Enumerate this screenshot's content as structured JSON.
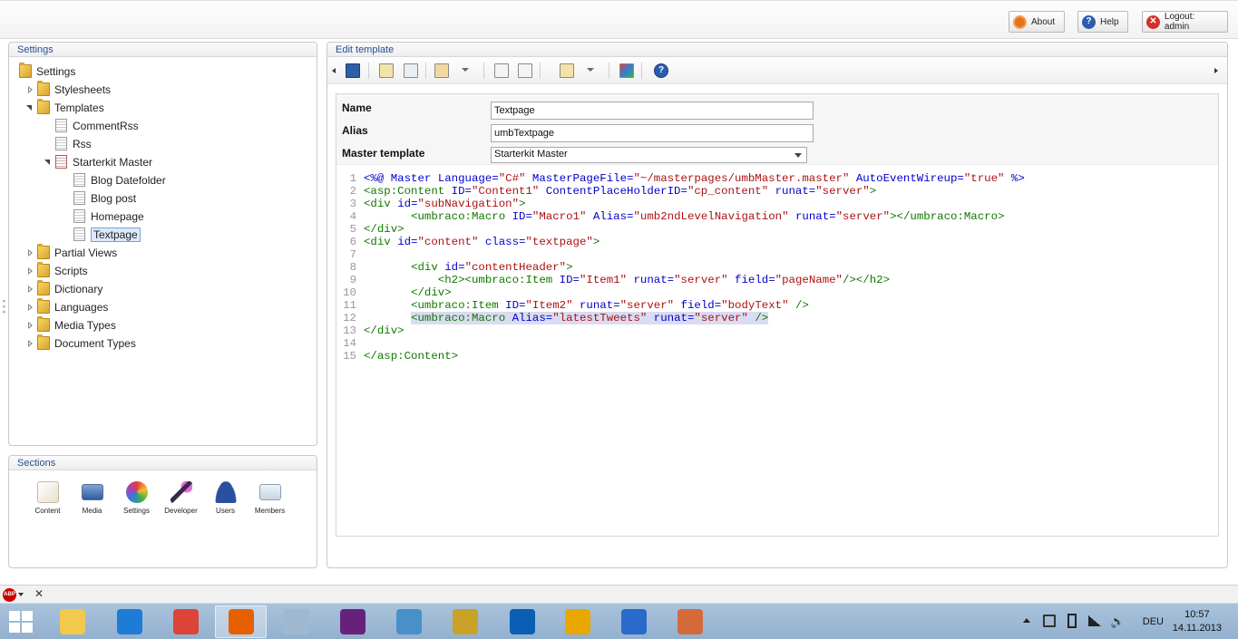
{
  "topbar": {
    "about_label": "About",
    "help_label": "Help",
    "logout_label": "Logout: admin"
  },
  "settings_panel": {
    "title": "Settings",
    "tree": [
      {
        "label": "Settings"
      },
      {
        "label": "Stylesheets"
      },
      {
        "label": "Templates"
      },
      {
        "label": "CommentRss"
      },
      {
        "label": "Rss"
      },
      {
        "label": "Starterkit Master"
      },
      {
        "label": "Blog Datefolder"
      },
      {
        "label": "Blog post"
      },
      {
        "label": "Homepage"
      },
      {
        "label": "Textpage"
      },
      {
        "label": "Partial Views"
      },
      {
        "label": "Scripts"
      },
      {
        "label": "Dictionary"
      },
      {
        "label": "Languages"
      },
      {
        "label": "Media Types"
      },
      {
        "label": "Document Types"
      }
    ]
  },
  "sections_panel": {
    "title": "Sections",
    "items": [
      {
        "label": "Content",
        "icon": "content-icon",
        "color": "#e8e0d0"
      },
      {
        "label": "Media",
        "icon": "media-icon",
        "color": "#5a88c8"
      },
      {
        "label": "Settings",
        "icon": "settings-icon",
        "color": "#e0a030"
      },
      {
        "label": "Developer",
        "icon": "developer-icon",
        "color": "#8a3aa8"
      },
      {
        "label": "Users",
        "icon": "users-icon",
        "color": "#2a4f9e"
      },
      {
        "label": "Members",
        "icon": "members-icon",
        "color": "#b8c8d8"
      }
    ]
  },
  "editor": {
    "title": "Edit template",
    "name_label": "Name",
    "name_value": "Textpage",
    "alias_label": "Alias",
    "alias_value": "umbTextpage",
    "master_label": "Master template",
    "master_value": "Starterkit Master",
    "code_lines": [
      {
        "n": "1",
        "parts": [
          [
            "t-dir",
            "<%@ "
          ],
          [
            "t-dir",
            "Master "
          ],
          [
            "t-att",
            "Language="
          ],
          [
            "t-str",
            "\"C#\""
          ],
          [
            "t-att",
            " MasterPageFile="
          ],
          [
            "t-str",
            "\"~/masterpages/umbMaster.master\""
          ],
          [
            "t-att",
            " AutoEventWireup="
          ],
          [
            "t-str",
            "\"true\""
          ],
          [
            "t-dir",
            " %>"
          ]
        ]
      },
      {
        "n": "2",
        "parts": [
          [
            "t-tag",
            "<asp:Content "
          ],
          [
            "t-att",
            "ID="
          ],
          [
            "t-str",
            "\"Content1\""
          ],
          [
            "t-att",
            " ContentPlaceHolderID="
          ],
          [
            "t-str",
            "\"cp_content\""
          ],
          [
            "t-att",
            " runat="
          ],
          [
            "t-str",
            "\"server\""
          ],
          [
            "t-tag",
            ">"
          ]
        ]
      },
      {
        "n": "3",
        "parts": [
          [
            "t-tag",
            "<div "
          ],
          [
            "t-att",
            "id="
          ],
          [
            "t-str",
            "\"subNavigation\""
          ],
          [
            "t-tag",
            ">"
          ]
        ]
      },
      {
        "n": "4",
        "parts": [
          [
            "",
            "       "
          ],
          [
            "t-tag",
            "<umbraco:Macro "
          ],
          [
            "t-att",
            "ID="
          ],
          [
            "t-str",
            "\"Macro1\""
          ],
          [
            "t-att",
            " Alias="
          ],
          [
            "t-str",
            "\"umb2ndLevelNavigation\""
          ],
          [
            "t-att",
            " runat="
          ],
          [
            "t-str",
            "\"server\""
          ],
          [
            "t-tag",
            "></umbraco:Macro>"
          ]
        ]
      },
      {
        "n": "5",
        "parts": [
          [
            "t-tag",
            "</div>"
          ]
        ]
      },
      {
        "n": "6",
        "parts": [
          [
            "t-tag",
            "<div "
          ],
          [
            "t-att",
            "id="
          ],
          [
            "t-str",
            "\"content\""
          ],
          [
            "t-att",
            " class="
          ],
          [
            "t-str",
            "\"textpage\""
          ],
          [
            "t-tag",
            ">"
          ]
        ]
      },
      {
        "n": "7",
        "parts": []
      },
      {
        "n": "8",
        "parts": [
          [
            "",
            "       "
          ],
          [
            "t-tag",
            "<div "
          ],
          [
            "t-att",
            "id="
          ],
          [
            "t-str",
            "\"contentHeader\""
          ],
          [
            "t-tag",
            ">"
          ]
        ]
      },
      {
        "n": "9",
        "parts": [
          [
            "",
            "           "
          ],
          [
            "t-tag",
            "<h2><umbraco:Item "
          ],
          [
            "t-att",
            "ID="
          ],
          [
            "t-str",
            "\"Item1\""
          ],
          [
            "t-att",
            " runat="
          ],
          [
            "t-str",
            "\"server\""
          ],
          [
            "t-att",
            " field="
          ],
          [
            "t-str",
            "\"pageName\""
          ],
          [
            "t-tag",
            "/></h2>"
          ]
        ]
      },
      {
        "n": "10",
        "parts": [
          [
            "",
            "       "
          ],
          [
            "t-tag",
            "</div>"
          ]
        ]
      },
      {
        "n": "11",
        "parts": [
          [
            "",
            "       "
          ],
          [
            "t-tag",
            "<umbraco:Item "
          ],
          [
            "t-att",
            "ID="
          ],
          [
            "t-str",
            "\"Item2\""
          ],
          [
            "t-att",
            " runat="
          ],
          [
            "t-str",
            "\"server\""
          ],
          [
            "t-att",
            " field="
          ],
          [
            "t-str",
            "\"bodyText\""
          ],
          [
            "t-tag",
            " />"
          ]
        ]
      },
      {
        "n": "12",
        "hl": true,
        "parts": [
          [
            "",
            "       "
          ],
          [
            "t-tag",
            "<umbraco:Macro "
          ],
          [
            "t-att",
            "Alias="
          ],
          [
            "t-str",
            "\"latestTweets\""
          ],
          [
            "t-att",
            " runat="
          ],
          [
            "t-str",
            "\"server\""
          ],
          [
            "t-tag",
            " />"
          ]
        ]
      },
      {
        "n": "13",
        "parts": [
          [
            "t-tag",
            "</div>"
          ]
        ]
      },
      {
        "n": "14",
        "parts": []
      },
      {
        "n": "15",
        "parts": [
          [
            "t-tag",
            "</asp:Content>"
          ]
        ]
      }
    ]
  },
  "taskbar": {
    "language": "DEU",
    "time": "10:57",
    "date": "14.11.2013",
    "apps": [
      {
        "icon": "explorer-icon",
        "color": "#f2c94c"
      },
      {
        "icon": "internet-explorer-icon",
        "color": "#1e7bd6"
      },
      {
        "icon": "chrome-icon",
        "color": "#db4437"
      },
      {
        "icon": "firefox-icon",
        "color": "#e66000"
      },
      {
        "icon": "server-icon",
        "color": "#9fb8cf"
      },
      {
        "icon": "visual-studio-icon",
        "color": "#68217a"
      },
      {
        "icon": "image-viewer-icon",
        "color": "#4a90c8"
      },
      {
        "icon": "tools-icon",
        "color": "#c9a227"
      },
      {
        "icon": "outlook-icon",
        "color": "#0a5fb4"
      },
      {
        "icon": "keys-icon",
        "color": "#e8a800"
      },
      {
        "icon": "messenger-icon",
        "color": "#2a6acb"
      },
      {
        "icon": "paint-icon",
        "color": "#d46a3a"
      }
    ]
  }
}
